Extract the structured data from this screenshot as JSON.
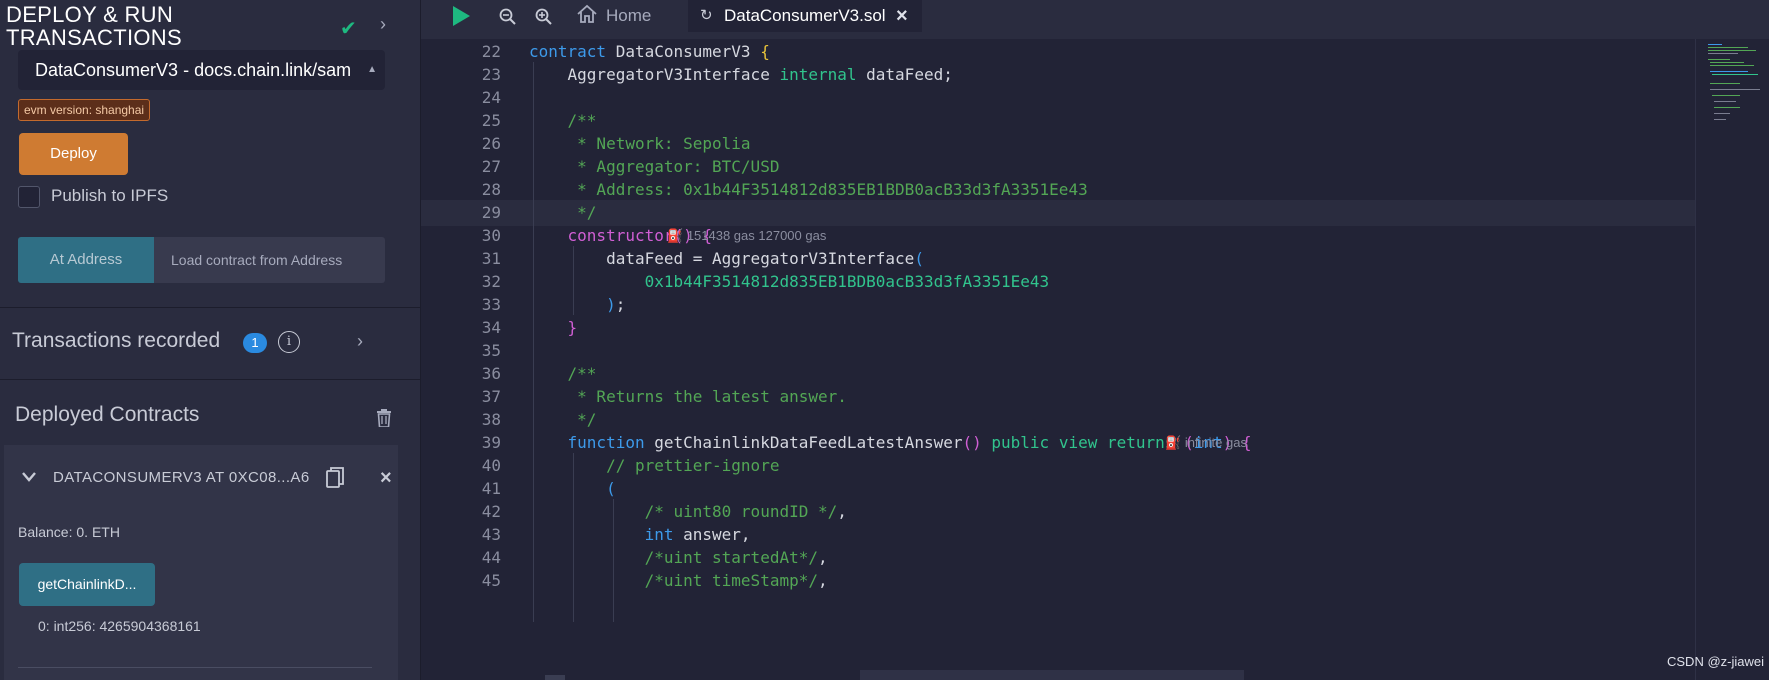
{
  "left": {
    "title": "DEPLOY & RUN TRANSACTIONS",
    "contract_select": "DataConsumerV3 - docs.chain.link/sam",
    "evm_badge": "evm version: shanghai",
    "deploy_label": "Deploy",
    "publish_label": "Publish to IPFS",
    "at_address_label": "At Address",
    "load_placeholder": "Load contract from Address",
    "transactions_label": "Transactions recorded",
    "transactions_count": "1",
    "deployed_label": "Deployed Contracts",
    "contract_instance": "DATACONSUMERV3 AT 0XC08...A6",
    "balance": "Balance: 0. ETH",
    "function_button": "getChainlinkD...",
    "function_output": "0: int256: 4265904368161"
  },
  "tabs": {
    "home": "Home",
    "file": "DataConsumerV3.sol"
  },
  "editor": {
    "gas_constructor": "151438 gas  127000 gas",
    "gas_function": "infinite gas"
  },
  "watermark": "CSDN @z-jiawei",
  "colors": {
    "accent": "#cf7b32",
    "primary": "#2f6f85",
    "success": "#1eb980",
    "badge_blue": "#2a8ae0"
  }
}
